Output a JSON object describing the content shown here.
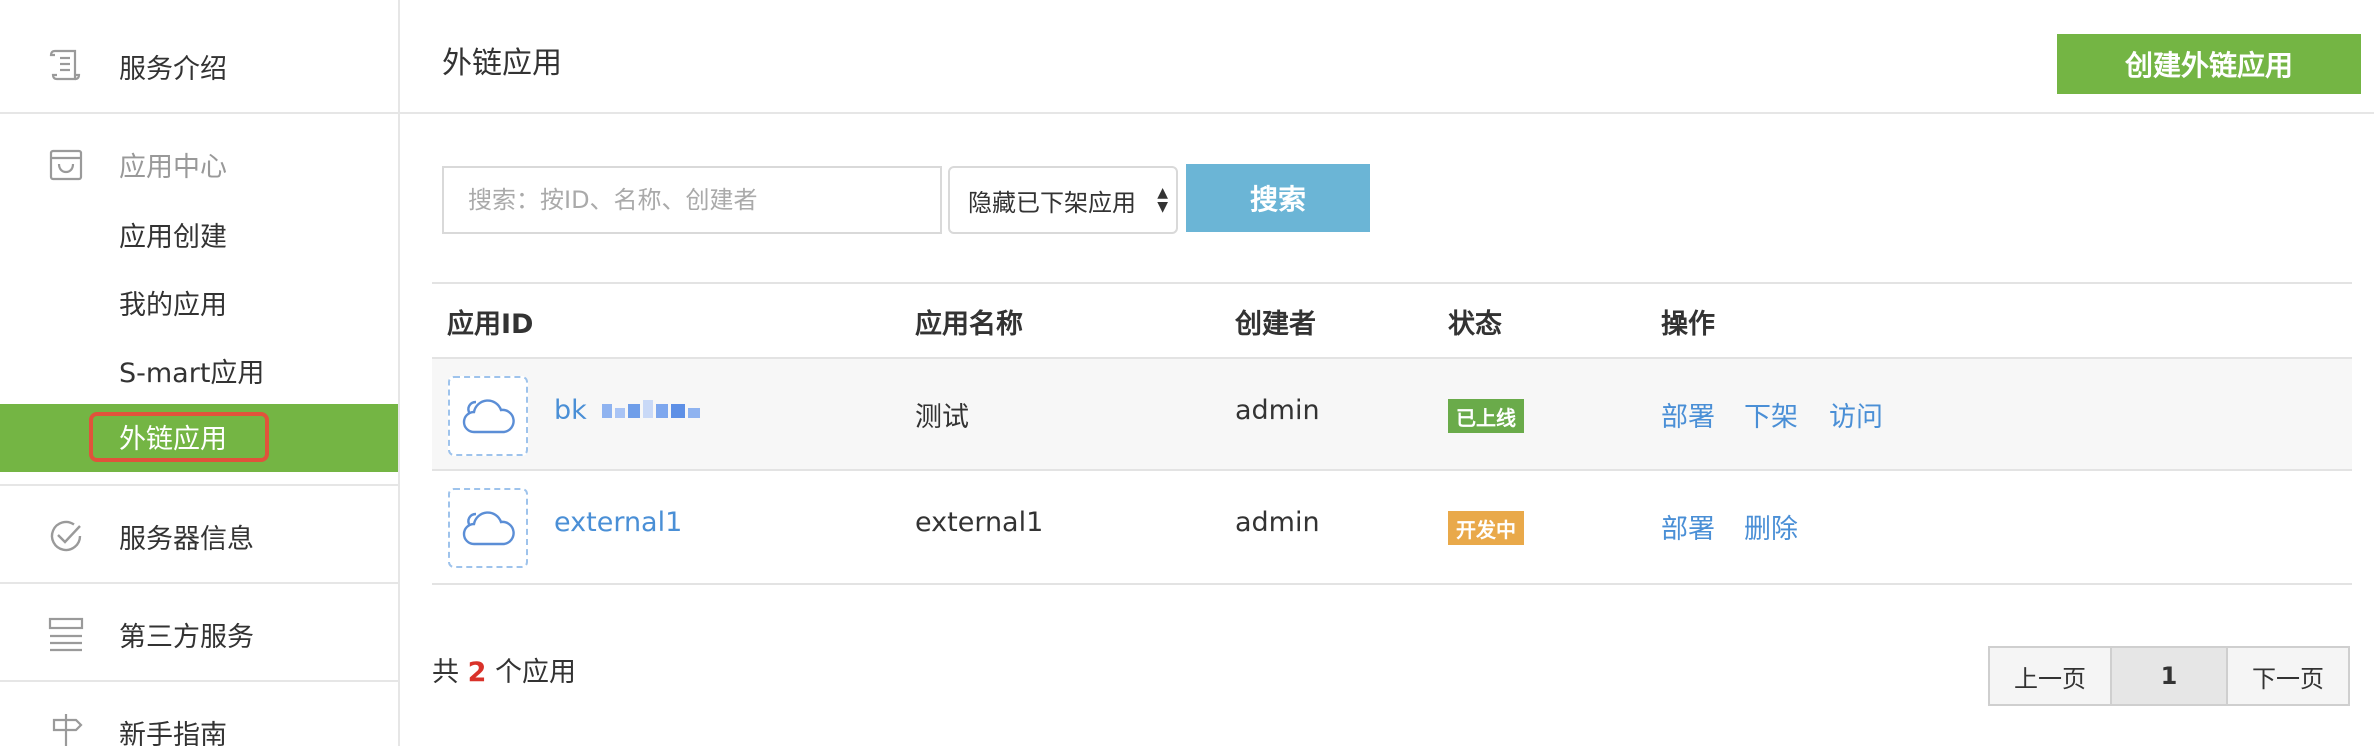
{
  "sidebar": {
    "items": [
      {
        "label": "服务介绍",
        "icon": "scroll-icon"
      },
      {
        "label": "应用中心",
        "icon": "shopping-bag-icon"
      },
      {
        "label": "服务器信息",
        "icon": "check-circle-icon"
      },
      {
        "label": "第三方服务",
        "icon": "list-stack-icon"
      },
      {
        "label": "新手指南",
        "icon": "signpost-icon"
      }
    ],
    "sub_items": [
      "应用创建",
      "我的应用",
      "S-mart应用",
      "外链应用"
    ],
    "active_color": "#74b544"
  },
  "header": {
    "title": "外链应用",
    "create_button": "创建外链应用"
  },
  "search": {
    "placeholder": "搜索：按ID、名称、创建者",
    "filter_value": "隐藏已下架应用",
    "button": "搜索"
  },
  "table": {
    "columns": [
      "应用ID",
      "应用名称",
      "创建者",
      "状态",
      "操作"
    ],
    "rows": [
      {
        "id": "bk",
        "name": "测试",
        "creator": "admin",
        "status": "已上线",
        "status_color": "#6aab4a",
        "actions": [
          "部署",
          "下架",
          "访问"
        ]
      },
      {
        "id": "external1",
        "name": "external1",
        "creator": "admin",
        "status": "开发中",
        "status_color": "#e9a94a",
        "actions": [
          "部署",
          "删除"
        ]
      }
    ]
  },
  "footer": {
    "total_prefix": "共",
    "total_count": "2",
    "total_suffix": "个应用",
    "pager": {
      "prev": "上一页",
      "current": "1",
      "next": "下一页"
    }
  }
}
